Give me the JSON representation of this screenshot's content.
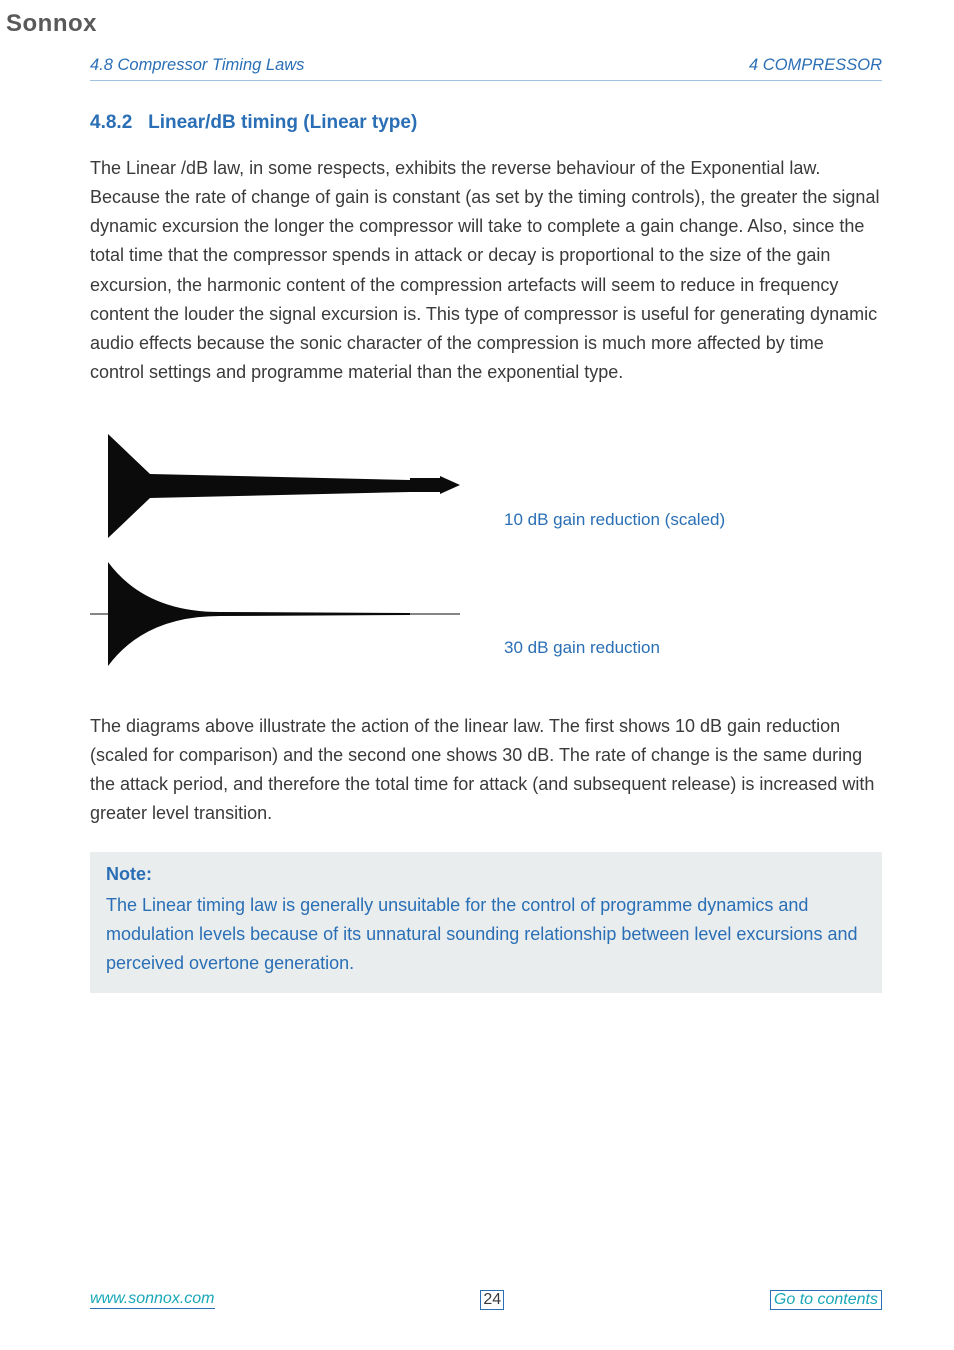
{
  "logo": "Sonnox",
  "header": {
    "left": "4.8   Compressor Timing Laws",
    "right": "4   COMPRESSOR"
  },
  "section": {
    "number": "4.8.2",
    "title": "Linear/dB timing (Linear type)"
  },
  "paragraph1": "The Linear /dB law, in some respects, exhibits the reverse behaviour of the Exponential law. Because the rate of change of gain is constant (as set by the timing controls), the greater the signal dynamic excursion the longer the compressor will take to complete a gain change. Also, since the total time that the compressor spends in attack or decay is proportional to the size of the gain excursion, the harmonic content of the compression artefacts will seem to reduce in frequency content the louder the signal excursion is. This type of compressor is useful for generating dynamic audio effects because the sonic character of the compression is much more affected by time control settings and programme material than the exponential type.",
  "figures": {
    "caption1": "10 dB gain reduction (scaled)",
    "caption2": "30 dB gain reduction"
  },
  "paragraph2": "The diagrams above illustrate the action of the linear law. The first shows 10 dB gain reduction (scaled for comparison) and the second one shows 30 dB. The rate of change is the same during the attack period, and therefore the total time for attack (and subsequent release) is increased with greater level transition.",
  "note": {
    "title": "Note:",
    "text": "The Linear timing law is generally unsuitable for the control of programme dynamics and modulation levels because of its unnatural sounding relationship between level excursions and perceived overtone generation."
  },
  "footer": {
    "left": "www.sonnox.com",
    "page": "24",
    "right": "Go to contents"
  }
}
